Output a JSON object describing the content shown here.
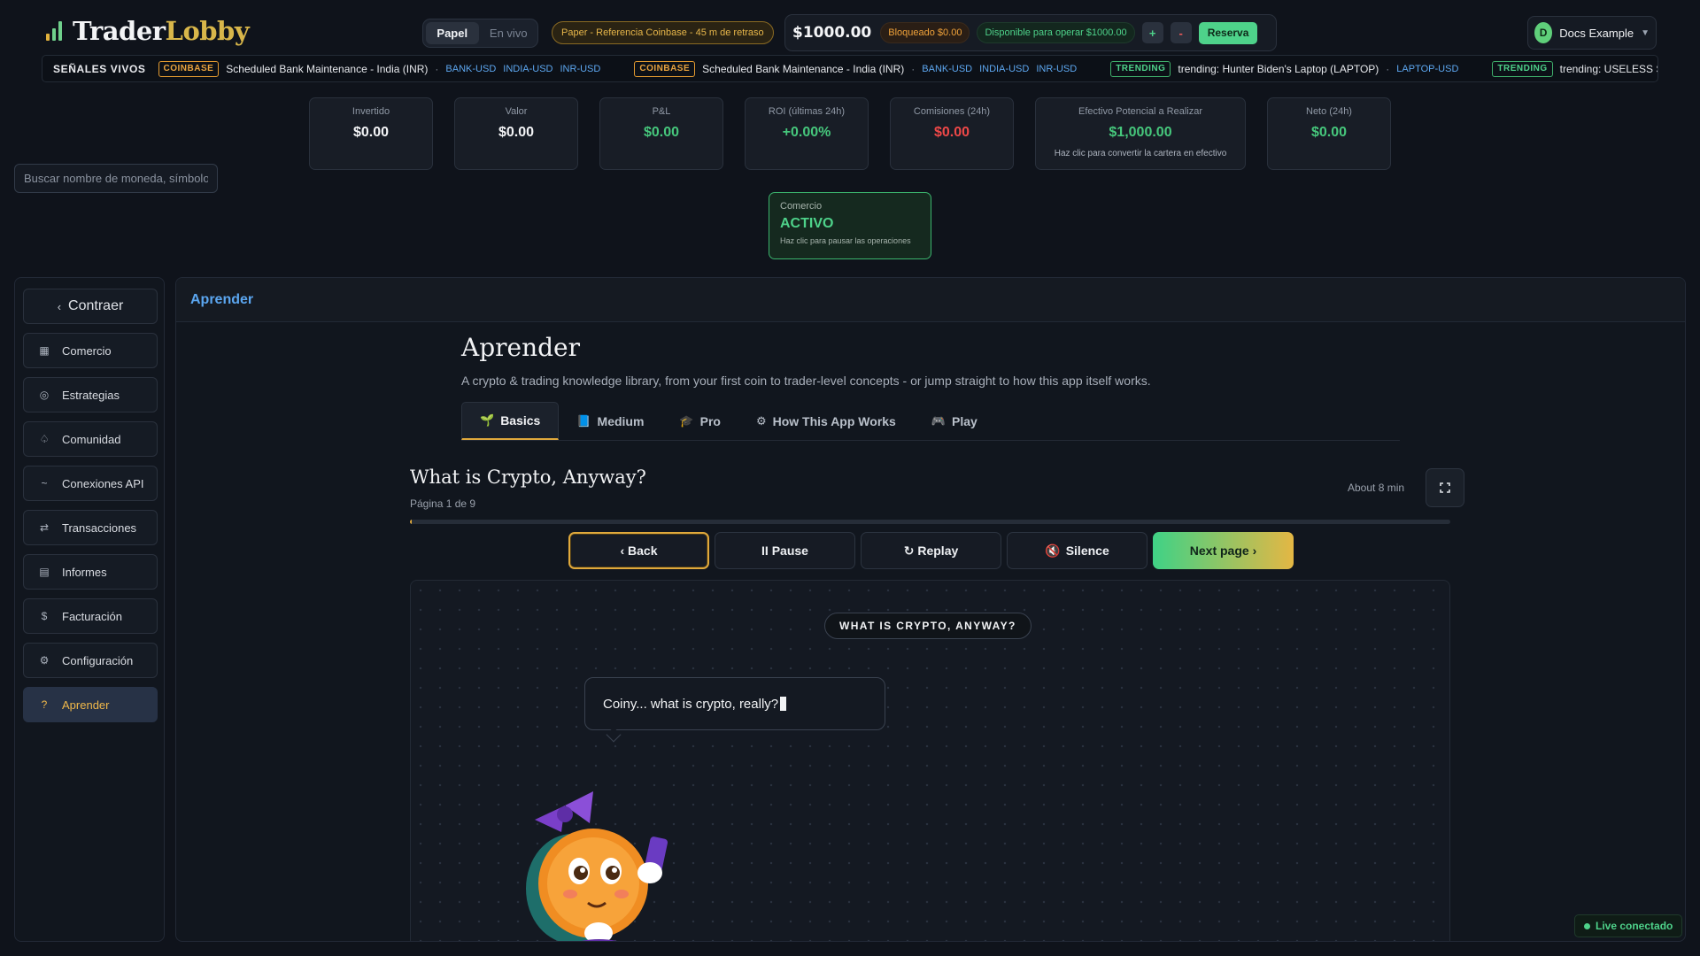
{
  "brand": {
    "part1": "Trader",
    "part2": "Lobby"
  },
  "mode": {
    "paper": "Papel",
    "live": "En vivo"
  },
  "paper_reference": "Paper - Referencia Coinbase - 45 m de retraso",
  "balance": {
    "amount": "$1000.00",
    "locked": "Bloqueado $0.00",
    "available": "Disponible para operar $1000.00",
    "plus": "+",
    "minus": "-",
    "reserve": "Reserva"
  },
  "user": {
    "initial": "D",
    "name": "Docs Example"
  },
  "ticker": {
    "label": "SEÑALES VIVOS",
    "items": [
      {
        "badge": "COINBASE",
        "kind": "coinbase",
        "text": "Scheduled Bank Maintenance - India (INR)",
        "symbols": [
          "BANK-USD",
          "INDIA-USD",
          "INR-USD"
        ]
      },
      {
        "badge": "COINBASE",
        "kind": "coinbase",
        "text": "Scheduled Bank Maintenance - India (INR)",
        "symbols": [
          "BANK-USD",
          "INDIA-USD",
          "INR-USD"
        ]
      },
      {
        "badge": "TRENDING",
        "kind": "trending",
        "text": "trending: Hunter Biden's Laptop (LAPTOP)",
        "symbols": [
          "LAPTOP-USD"
        ]
      },
      {
        "badge": "TRENDING",
        "kind": "trending",
        "text": "trending: USELESS STONK (STON",
        "symbols": []
      }
    ]
  },
  "stats": [
    {
      "label": "Invertido",
      "value": "$0.00",
      "color": "white"
    },
    {
      "label": "Valor",
      "value": "$0.00",
      "color": "white"
    },
    {
      "label": "P&L",
      "value": "$0.00",
      "color": "green"
    },
    {
      "label": "ROI (últimas 24h)",
      "value": "+0.00%",
      "color": "green"
    },
    {
      "label": "Comisiones (24h)",
      "value": "$0.00",
      "color": "red"
    },
    {
      "label": "Efectivo Potencial a Realizar",
      "value": "$1,000.00",
      "color": "green",
      "sub": "Haz clic para convertir la cartera en efectivo"
    },
    {
      "label": "Neto (24h)",
      "value": "$0.00",
      "color": "green"
    }
  ],
  "search": {
    "placeholder": "Buscar nombre de moneda, símbolo",
    "value": ""
  },
  "trade_status": {
    "label": "Comercio",
    "value": "ACTIVO",
    "sub": "Haz clic para pausar las operaciones"
  },
  "sidebar": {
    "collapse": "Contraer",
    "items": [
      {
        "label": "Comercio",
        "icon": "grid-icon"
      },
      {
        "label": "Estrategias",
        "icon": "target-icon"
      },
      {
        "label": "Comunidad",
        "icon": "community-icon"
      },
      {
        "label": "Conexiones API",
        "icon": "api-icon"
      },
      {
        "label": "Transacciones",
        "icon": "swap-icon"
      },
      {
        "label": "Informes",
        "icon": "report-icon"
      },
      {
        "label": "Facturación",
        "icon": "dollar-icon"
      },
      {
        "label": "Configuración",
        "icon": "gear-icon"
      },
      {
        "label": "Aprender",
        "icon": "question-icon",
        "active": true
      }
    ]
  },
  "main": {
    "header": "Aprender",
    "title": "Aprender",
    "description": "A crypto & trading knowledge library, from your first coin to trader-level concepts - or jump straight to how this app itself works.",
    "tabs": [
      {
        "label": "Basics",
        "icon": "🌱",
        "active": true
      },
      {
        "label": "Medium",
        "icon": "📘"
      },
      {
        "label": "Pro",
        "icon": "🎓"
      },
      {
        "label": "How This App Works",
        "icon": "⚙"
      },
      {
        "label": "Play",
        "icon": "🎮"
      }
    ],
    "lesson": {
      "title": "What is Crypto, Anyway?",
      "page": "Página 1 de 9",
      "read_time": "About 8 min",
      "progress": 0.002
    },
    "controls": {
      "back": "‹ Back",
      "pause": "II Pause",
      "replay": "↻ Replay",
      "silence": "Silence",
      "next": "Next page ›"
    },
    "stage": {
      "label": "WHAT IS CRYPTO, ANYWAY?",
      "bubble": "Coiny... what is crypto, really?"
    }
  },
  "status": {
    "live": "Live conectado"
  }
}
